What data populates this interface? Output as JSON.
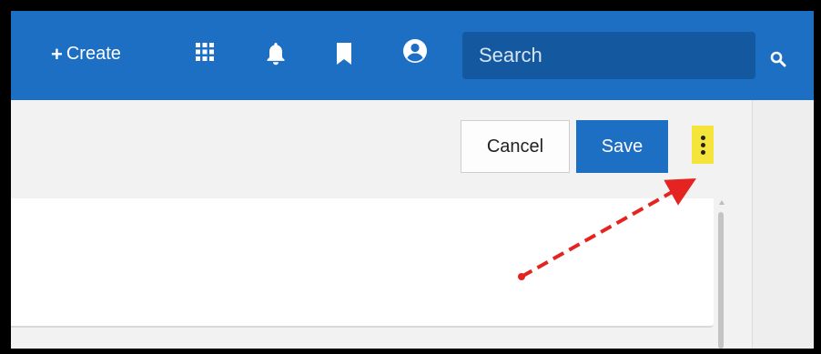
{
  "topbar": {
    "create_label": "Create",
    "create_prefix": "+",
    "icons": [
      "apps-grid-icon",
      "bell-icon",
      "bookmark-icon",
      "user-account-icon"
    ],
    "search_placeholder": "Search",
    "search_icon": "search-icon"
  },
  "actions": {
    "cancel_label": "Cancel",
    "save_label": "Save",
    "more_icon": "vertical-ellipsis-icon"
  },
  "colors": {
    "brand_blue": "#1d6fc4",
    "search_bg": "#14589f",
    "highlight_yellow": "#f5e53a",
    "annotation_red": "#e52421"
  },
  "annotation": {
    "type": "dashed-arrow",
    "points_to": "more-options-button"
  }
}
